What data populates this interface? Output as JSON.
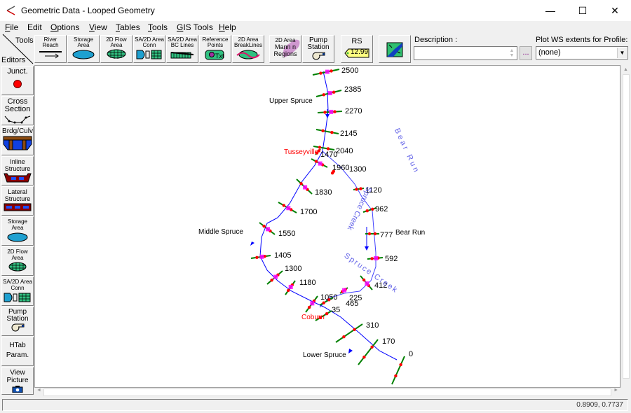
{
  "window": {
    "title": "Geometric Data - Looped Geometry",
    "minimize": "—",
    "maximize": "☐",
    "close": "✕"
  },
  "menu": [
    {
      "label": "File",
      "accel": "F",
      "rest": "ile"
    },
    {
      "label": "Edit",
      "accel": "",
      "rest": "Edit"
    },
    {
      "label": "Options",
      "accel": "O",
      "rest": "ptions"
    },
    {
      "label": "View",
      "accel": "V",
      "rest": "iew"
    },
    {
      "label": "Tables",
      "accel": "T",
      "rest": "ables"
    },
    {
      "label": "Tools",
      "accel": "T",
      "rest": "ools"
    },
    {
      "label": "GIS Tools",
      "accel": "G",
      "rest": "IS Tools"
    },
    {
      "label": "Help",
      "accel": "H",
      "rest": "elp"
    }
  ],
  "toolbar": {
    "tools_label": "Tools",
    "editors_label": "Editors",
    "buttons": [
      {
        "line1": "River",
        "line2": "Reach"
      },
      {
        "line1": "Storage",
        "line2": "Area"
      },
      {
        "line1": "2D Flow",
        "line2": "Area"
      },
      {
        "line1": "SA/2D Area",
        "line2": "Conn"
      },
      {
        "line1": "SA/2D Area",
        "line2": "BC Lines"
      },
      {
        "line1": "Reference",
        "line2": "Points"
      },
      {
        "line1": "2D Area",
        "line2": "BreakLines"
      },
      {
        "line1": "2D Area",
        "line2": "Mann n",
        "line3": "Regions"
      },
      {
        "line1": "Pump",
        "line2": "Station"
      },
      {
        "line1": "RS",
        "tag": "12.99"
      },
      {
        "line1": ""
      }
    ],
    "description_label": "Description :",
    "description_value": "",
    "ellipsis_label": "...",
    "plot_ws_label": "Plot WS extents for Profile:",
    "plot_ws_value": "(none)"
  },
  "editors": [
    {
      "line1": "Junct."
    },
    {
      "line1": "Cross",
      "line2": "Section"
    },
    {
      "line1": "Brdg/Culv"
    },
    {
      "line1": "Inline",
      "line2": "Structure"
    },
    {
      "line1": "Lateral",
      "line2": "Structure"
    },
    {
      "line1": "Storage",
      "line2": "Area"
    },
    {
      "line1": "2D Flow",
      "line2": "Area"
    },
    {
      "line1": "SA/2D Area",
      "line2": "Conn"
    },
    {
      "line1": "Pump",
      "line2": "Station"
    },
    {
      "line1": "HTab",
      "line2": "Param."
    },
    {
      "line1": "View",
      "line2": "Picture"
    }
  ],
  "map": {
    "reach_labels": {
      "upper": "Upper Spruce",
      "middle": "Middle Spruce",
      "bear": "Bear Run",
      "lower": "Lower Spruce"
    },
    "junctions": {
      "tusseyville": "Tusseyville",
      "coburn": "Coburn"
    },
    "river_labels": {
      "spruce_middle": "Spruce Creek",
      "bear": "Bear Run",
      "spruce_lower": "Spruce Creek"
    },
    "stations_upper": [
      "2500",
      "2385",
      "2270",
      "2145",
      "2040"
    ],
    "stations_middle": [
      "1960",
      "1830",
      "1700",
      "1550",
      "1405",
      "1300",
      "1180",
      "1050",
      "465"
    ],
    "stations_bear": [
      "1470",
      "1300",
      "1120",
      "962",
      "777",
      "592",
      "412",
      "225",
      "35"
    ],
    "stations_lower": [
      "310",
      "170",
      "0"
    ],
    "colors": {
      "river": "#0000ff",
      "xs": "#008000",
      "bank": "#ff0000",
      "junction": "#ff0000",
      "marker": "#ff00ff"
    }
  },
  "status": {
    "coords": "0.8909, 0.7737"
  }
}
